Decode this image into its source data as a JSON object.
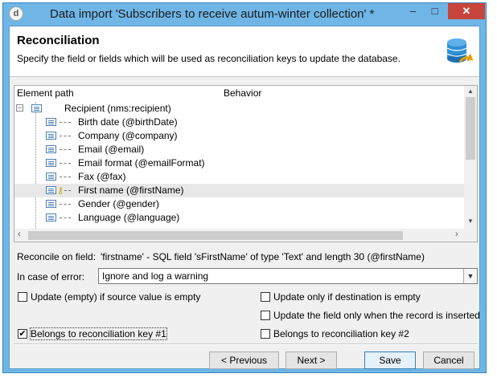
{
  "window": {
    "title": "Data import 'Subscribers to receive autum-winter collection' *",
    "minimize": "–",
    "maximize": "□",
    "close": "✕",
    "app_icon": "d"
  },
  "header": {
    "title": "Reconciliation",
    "description": "Specify the field or fields which will be used as reconciliation keys to update the database.",
    "icon": "database-icon"
  },
  "tree": {
    "columns": [
      "Element path",
      "Behavior"
    ],
    "root": "Recipient (nms:recipient)",
    "root_toggle": "−",
    "items": [
      {
        "label": "Birth date (@birthDate)",
        "key": false
      },
      {
        "label": "Company (@company)",
        "key": false
      },
      {
        "label": "Email (@email)",
        "key": false
      },
      {
        "label": "Email format (@emailFormat)",
        "key": false
      },
      {
        "label": "Fax (@fax)",
        "key": false
      },
      {
        "label": "First name (@firstName)",
        "key": true,
        "selected": true
      },
      {
        "label": "Gender (@gender)",
        "key": false
      },
      {
        "label": "Language (@language)",
        "key": false
      }
    ]
  },
  "reconcile": {
    "label": "Reconcile on field:",
    "value": "'firstname' - SQL field 'sFirstName' of type 'Text' and length 30 (@firstName)"
  },
  "error": {
    "label": "In case of error:",
    "value": "Ignore and log a warning"
  },
  "options": {
    "update_empty": {
      "label": "Update (empty) if source value is empty",
      "checked": false
    },
    "update_dest_empty": {
      "label": "Update only if destination is empty",
      "checked": false
    },
    "update_inserted": {
      "label": "Update the field only when the record is inserted",
      "checked": false
    },
    "key1": {
      "label": "Belongs to reconciliation key #1",
      "checked": true
    },
    "key2": {
      "label": "Belongs to reconciliation key #2",
      "checked": false
    }
  },
  "buttons": {
    "previous": "< Previous",
    "next": "Next >",
    "save": "Save",
    "cancel": "Cancel"
  }
}
